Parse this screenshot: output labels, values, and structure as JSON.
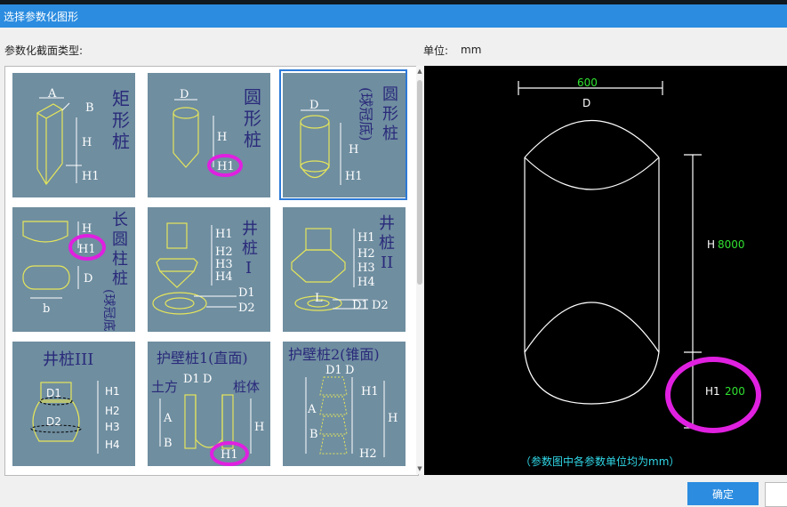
{
  "window": {
    "title": "选择参数化图形"
  },
  "header": {
    "section_type_label": "参数化截面类型:",
    "unit_label": "单位:",
    "unit_value": "mm"
  },
  "tiles": [
    {
      "labels": [
        "矩",
        "形",
        "桩"
      ],
      "dims": [
        "A",
        "B",
        "H",
        "H1"
      ]
    },
    {
      "labels": [
        "圆",
        "形",
        "桩"
      ],
      "dims": [
        "D",
        "H",
        "H1"
      ]
    },
    {
      "labels": [
        "圆",
        "形",
        "桩",
        "(球冠底)"
      ],
      "dims": [
        "D",
        "H",
        "H1"
      ]
    },
    {
      "labels": [
        "长",
        "圆",
        "柱",
        "桩",
        "(球冠底)"
      ],
      "dims": [
        "H",
        "H1",
        "D",
        "b"
      ]
    },
    {
      "labels": [
        "井",
        "桩",
        "I"
      ],
      "dims": [
        "H1",
        "H2",
        "H3",
        "H4",
        "D1",
        "D2"
      ]
    },
    {
      "labels": [
        "井",
        "桩",
        "II"
      ],
      "dims": [
        "H1",
        "H2",
        "H3",
        "H4",
        "L",
        "D1",
        "D2"
      ]
    },
    {
      "labels": [
        "井桩III"
      ],
      "dims": [
        "D1",
        "D2",
        "H1",
        "H2",
        "H3",
        "H4"
      ]
    },
    {
      "labels": [
        "护壁桩1(直面)",
        "土方",
        "桩体"
      ],
      "dims": [
        "D1",
        "D",
        "A",
        "B",
        "H",
        "H1"
      ]
    },
    {
      "labels": [
        "护壁桩2(锥面)"
      ],
      "dims": [
        "D1",
        "D",
        "H1",
        "A",
        "B",
        "H",
        "H2"
      ]
    }
  ],
  "preview": {
    "d_value": "600",
    "d_label": "D",
    "h_label": "H",
    "h_value": "8000",
    "h1_label": "H1",
    "h1_value": "200",
    "note": "（参数图中各参数单位均为mm）"
  },
  "buttons": {
    "ok": "确定"
  },
  "colors": {
    "title_bar": "#2b8ce0",
    "tile_bg": "#6f8ea0",
    "highlight": "#e020e0",
    "preview_value": "#30e030",
    "note": "#30d8e8"
  }
}
